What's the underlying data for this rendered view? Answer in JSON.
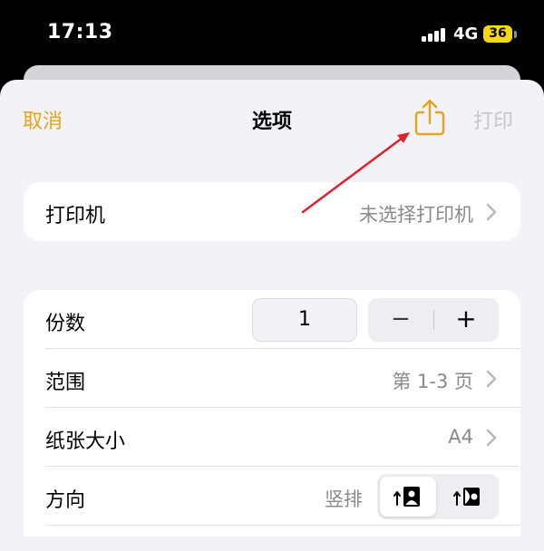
{
  "status_bar": {
    "time": "17:13",
    "network": "4G",
    "battery": "36"
  },
  "nav": {
    "cancel": "取消",
    "title": "选项",
    "share_icon": "share-icon",
    "print": "打印"
  },
  "printer_group": {
    "label": "打印机",
    "value": "未选择打印机"
  },
  "options_group": {
    "copies": {
      "label": "份数",
      "value": "1",
      "minus": "−",
      "plus": "+"
    },
    "range": {
      "label": "范围",
      "value": "第 1-3 页"
    },
    "paper_size": {
      "label": "纸张大小",
      "value": "A4"
    },
    "orientation": {
      "label": "方向",
      "value": "竖排",
      "options": [
        "portrait-icon",
        "landscape-icon"
      ],
      "selected": "portrait"
    }
  },
  "colors": {
    "accent": "#e3a51b",
    "arrow": "#e0202a",
    "disabled": "#c7c7cc",
    "background": "#f2f2f7"
  }
}
